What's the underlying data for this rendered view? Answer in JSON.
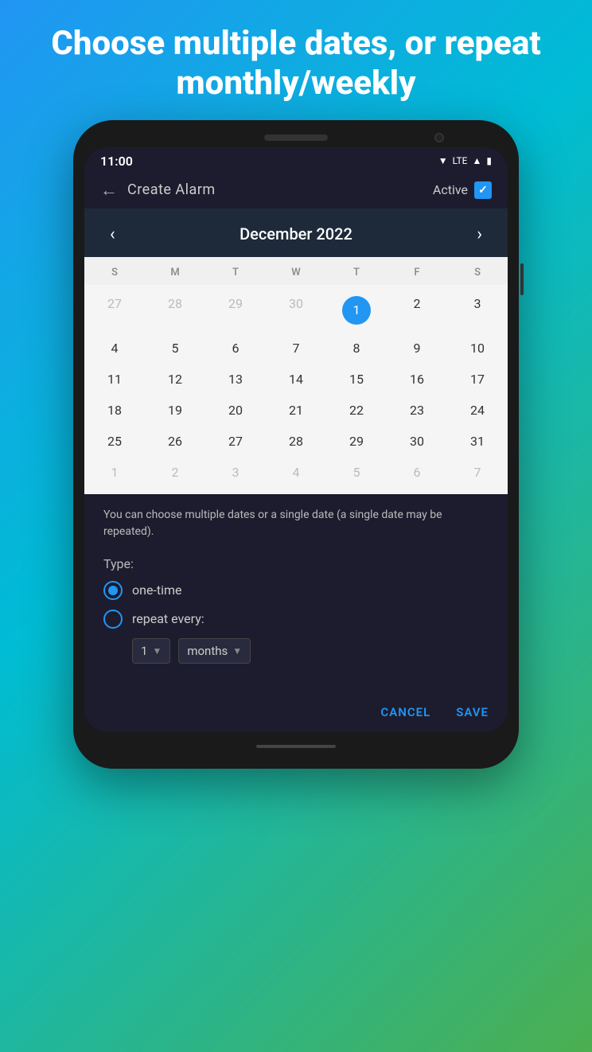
{
  "hero": {
    "title": "Choose multiple dates, or repeat monthly/weekly"
  },
  "statusBar": {
    "time": "11:00",
    "wifi": "▼",
    "lte": "LTE",
    "signal": "▲",
    "battery": "🔋"
  },
  "appBar": {
    "title": "Create Alarm",
    "activeLabel": "Active",
    "backIcon": "←"
  },
  "calendar": {
    "prevNav": "‹",
    "nextNav": "›",
    "monthYear": "December  2022",
    "weekdays": [
      "S",
      "M",
      "T",
      "W",
      "T",
      "F",
      "S"
    ],
    "weeks": [
      [
        {
          "day": "27",
          "otherMonth": true
        },
        {
          "day": "28",
          "otherMonth": true
        },
        {
          "day": "29",
          "otherMonth": true
        },
        {
          "day": "30",
          "otherMonth": true
        },
        {
          "day": "1",
          "selected": true
        },
        {
          "day": "2"
        },
        {
          "day": "3"
        }
      ],
      [
        {
          "day": "4"
        },
        {
          "day": "5"
        },
        {
          "day": "6"
        },
        {
          "day": "7"
        },
        {
          "day": "8"
        },
        {
          "day": "9"
        },
        {
          "day": "10"
        }
      ],
      [
        {
          "day": "11"
        },
        {
          "day": "12"
        },
        {
          "day": "13"
        },
        {
          "day": "14"
        },
        {
          "day": "15"
        },
        {
          "day": "16"
        },
        {
          "day": "17"
        }
      ],
      [
        {
          "day": "18"
        },
        {
          "day": "19"
        },
        {
          "day": "20"
        },
        {
          "day": "21"
        },
        {
          "day": "22"
        },
        {
          "day": "23"
        },
        {
          "day": "24"
        }
      ],
      [
        {
          "day": "25"
        },
        {
          "day": "26"
        },
        {
          "day": "27"
        },
        {
          "day": "28"
        },
        {
          "day": "29"
        },
        {
          "day": "30"
        },
        {
          "day": "31"
        }
      ],
      [
        {
          "day": "1",
          "otherMonth": true
        },
        {
          "day": "2",
          "otherMonth": true
        },
        {
          "day": "3",
          "otherMonth": true
        },
        {
          "day": "4",
          "otherMonth": true
        },
        {
          "day": "5",
          "otherMonth": true
        },
        {
          "day": "6",
          "otherMonth": true
        },
        {
          "day": "7",
          "otherMonth": true
        }
      ]
    ]
  },
  "description": "You can choose multiple dates or a single date (a single date may be repeated).",
  "type": {
    "label": "Type:",
    "options": [
      {
        "id": "one-time",
        "label": "one-time",
        "selected": true
      },
      {
        "id": "repeat",
        "label": "repeat every:",
        "selected": false
      }
    ]
  },
  "repeatEvery": {
    "value": "1",
    "unit": "months"
  },
  "actions": {
    "cancel": "CANCEL",
    "save": "SAVE"
  }
}
